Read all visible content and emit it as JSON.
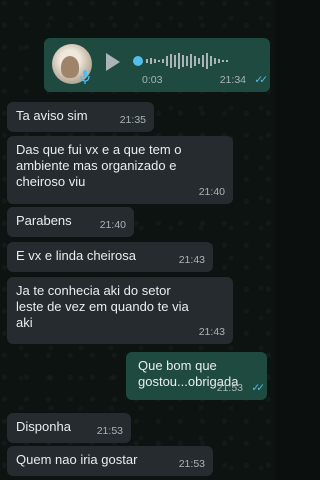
{
  "voice_message": {
    "duration": "0:03",
    "time": "21:34",
    "ticks": "✓✓",
    "progress": 0
  },
  "messages": [
    {
      "text": "Ta aviso sim",
      "time": "21:35"
    },
    {
      "text": "Das que fui vx e a que tem o\nambiente mas organizado e\ncheiroso viu",
      "time": "21:40"
    },
    {
      "text": "Parabens",
      "time": "21:40"
    },
    {
      "text": "E vx e linda cheirosa",
      "time": "21:43"
    },
    {
      "text": "Ja te conhecia aki do setor\nleste de vez em quando te via\naki",
      "time": "21:43"
    },
    {
      "text": "Que bom que\ngostou...obrigada",
      "time": "21:53",
      "ticks": "✓✓"
    },
    {
      "text": "Disponha",
      "time": "21:53"
    },
    {
      "text": "Quem nao iria gostar",
      "time": "21:53"
    }
  ],
  "colors": {
    "incoming_bubble": "#252b2e",
    "outgoing_bubble": "#1f4a3f",
    "read_ticks": "#53bdeb"
  }
}
